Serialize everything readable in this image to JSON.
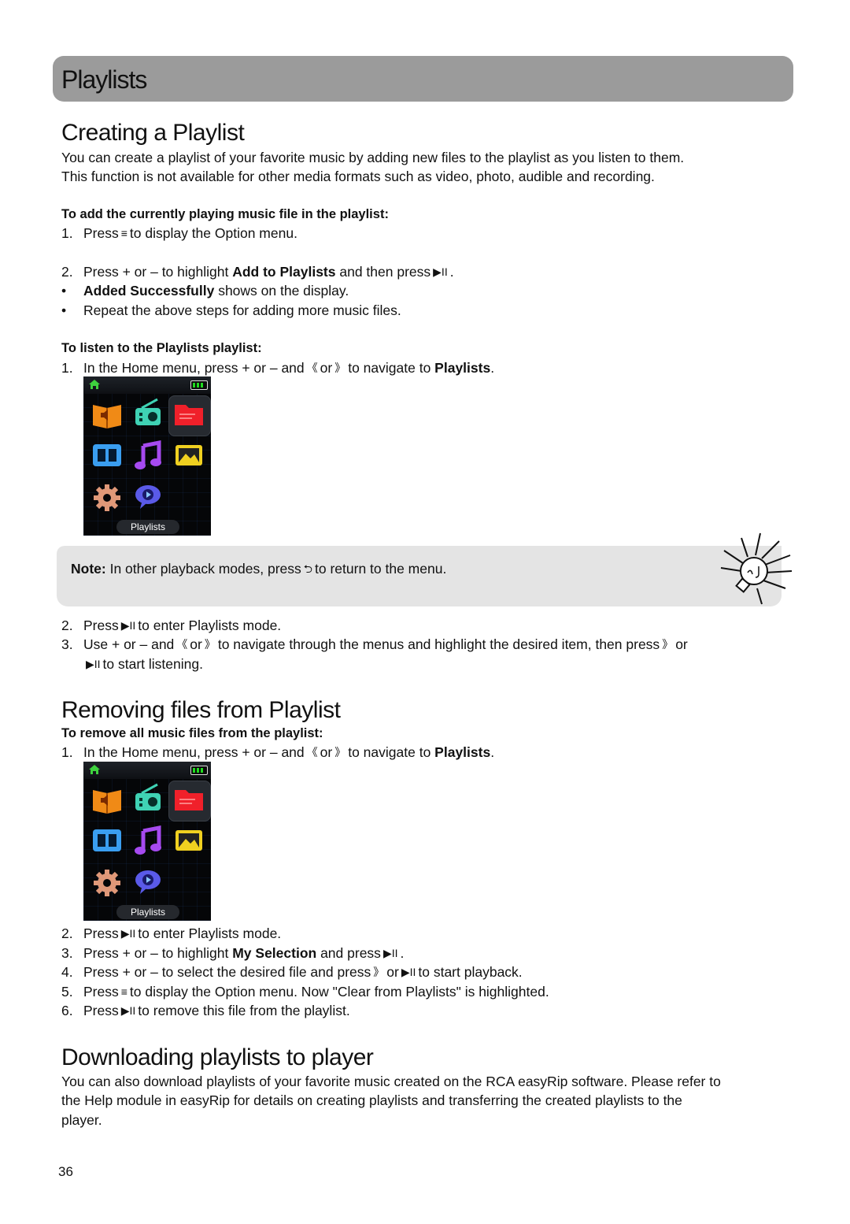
{
  "banner": {
    "title": "Playlists",
    "color": "#9b9b9b"
  },
  "creating": {
    "heading": "Creating a Playlist",
    "intro_line1": "You can create a playlist of your favorite music by adding new files to the playlist as you listen to them.",
    "intro_line2": "This function is not available for other media formats such as video, photo, audible and recording.",
    "add_subheading": "To add the currently playing music file in the playlist:",
    "add_step1": {
      "num": "1.",
      "pre": "Press",
      "icon": "menu-icon",
      "post": "to display the Option menu."
    },
    "add_step2": {
      "num": "2.",
      "pre": "Press + or – to highlight",
      "bold": "Add to Playlists",
      "post": "and then press",
      "icon": "play-pause-icon",
      "end": "."
    },
    "bullet1": {
      "bold": "Added Successfully",
      "post": "shows on the display."
    },
    "bullet2": {
      "text": "Repeat the above steps for adding more music files."
    },
    "listen_subheading": "To listen to the Playlists playlist:",
    "listen_step1": {
      "num": "1.",
      "pre": "In the Home menu, press + or – and",
      "mid": "or",
      "post": "to navigate to",
      "bold": "Playlists",
      "end": "."
    },
    "screen_label": "Playlists",
    "note": {
      "label": "Note:",
      "pre": "In other playback modes, press",
      "post": "to return to the menu."
    },
    "listen_step2": {
      "num": "2.",
      "pre": "Press",
      "post": "to enter Playlists mode."
    },
    "listen_step3": {
      "num": "3.",
      "pre": "Use  + or – and",
      "mid": "or",
      "post": "to navigate through the menus and highlight the desired item, then press",
      "end": "or",
      "line2": "to start listening."
    }
  },
  "removing": {
    "heading": "Removing files from Playlist",
    "subheading": "To remove all music files from the playlist:",
    "step1": {
      "num": "1.",
      "pre": "In the Home menu, press + or – and",
      "mid": "or",
      "post": "to navigate to",
      "bold": "Playlists",
      "end": "."
    },
    "screen_label": "Playlists",
    "step2": {
      "num": "2.",
      "pre": "Press",
      "post": "to enter Playlists mode."
    },
    "step3": {
      "num": "3.",
      "pre": "Press + or – to highlight",
      "bold": "My Selection",
      "post": "and press",
      "end": "."
    },
    "step4": {
      "num": "4.",
      "pre": "Press + or – to select the desired file and press",
      "mid": "or",
      "post": "to start playback."
    },
    "step5": {
      "num": "5.",
      "pre": "Press",
      "post": "to display the Option menu. Now \"Clear from Playlists\" is highlighted."
    },
    "step6": {
      "num": "6.",
      "pre": "Press",
      "post": "to remove this file from the playlist."
    }
  },
  "downloading": {
    "heading": "Downloading playlists to player",
    "line1": "You can also download playlists of your favorite music created on the RCA easyRip software. Please refer to",
    "line2": "the Help module in easyRip for details on creating playlists and transferring the created playlists to the",
    "line3": "player."
  },
  "glyphs": {
    "menu": "≡",
    "play_pause": "▶II",
    "prev": "《",
    "next": "》",
    "back": "⮌",
    "bullet": "•"
  },
  "page_number": "36"
}
